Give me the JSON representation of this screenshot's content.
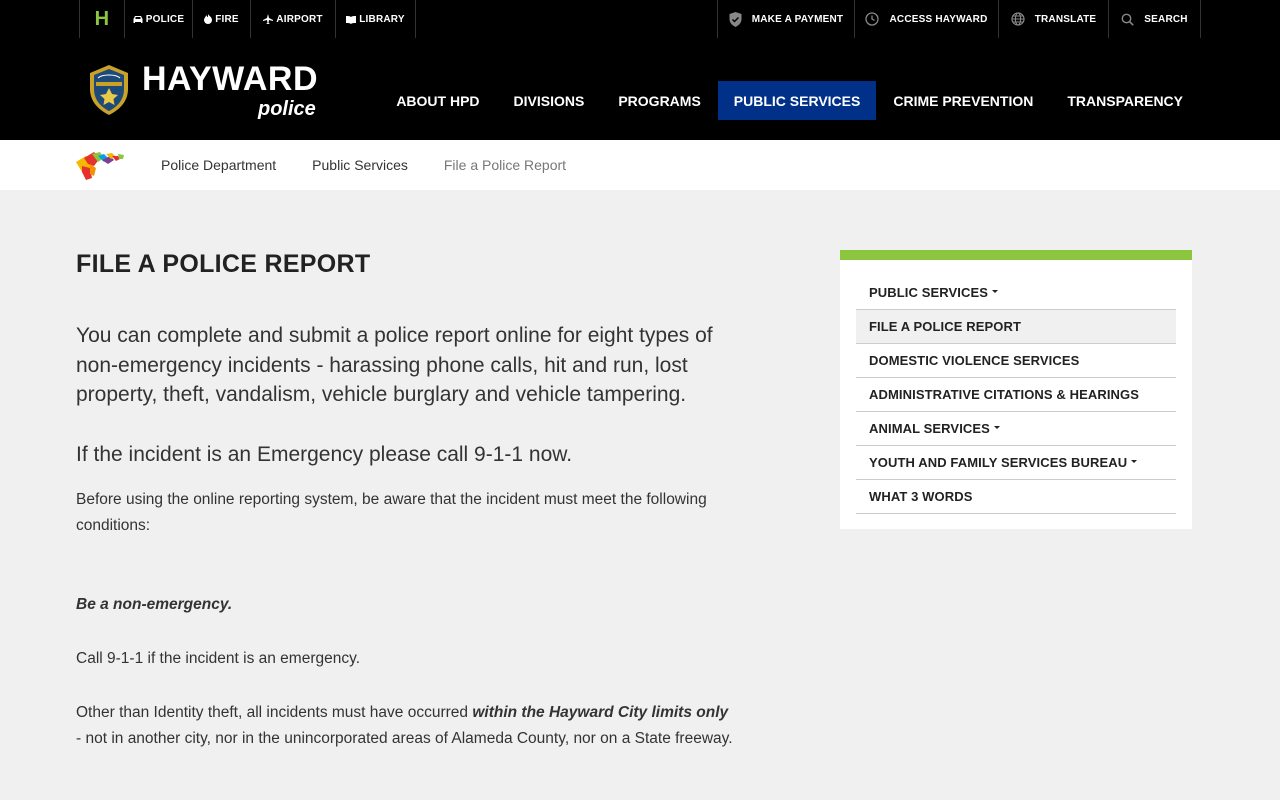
{
  "utility": {
    "home_label": "H",
    "left": [
      {
        "label": "POLICE",
        "icon": "car-icon"
      },
      {
        "label": "FIRE",
        "icon": "flame-icon"
      },
      {
        "label": "AIRPORT",
        "icon": "airplane-icon"
      },
      {
        "label": "LIBRARY",
        "icon": "book-icon"
      }
    ],
    "right": [
      {
        "label": "MAKE A PAYMENT",
        "icon": "shield-check-icon"
      },
      {
        "label": "ACCESS HAYWARD",
        "icon": "clock-icon"
      },
      {
        "label": "TRANSLATE",
        "icon": "globe-icon"
      },
      {
        "label": "SEARCH",
        "icon": "search-icon"
      }
    ]
  },
  "header": {
    "logo_title": "HAYWARD",
    "logo_subtitle": "police",
    "nav": [
      {
        "label": "ABOUT HPD"
      },
      {
        "label": "DIVISIONS"
      },
      {
        "label": "PROGRAMS"
      },
      {
        "label": "PUBLIC SERVICES",
        "active": true
      },
      {
        "label": "CRIME PREVENTION"
      },
      {
        "label": "TRANSPARENCY"
      }
    ]
  },
  "breadcrumb": {
    "items": [
      "Police Department",
      "Public Services"
    ],
    "current": "File a Police Report"
  },
  "content": {
    "title": "FILE A POLICE REPORT",
    "lead": "You can complete and submit a police report online for eight types of non-emergency incidents - harassing phone calls, hit and run, lost property, theft, vandalism, vehicle burglary and vehicle tampering.",
    "emergency": "If the incident is an Emergency please call 9-1-1 now.",
    "p1": "Before using the online reporting system, be aware that the incident must meet the following conditions:",
    "p2": "Be a non-emergency.",
    "p3": "Call 9-1-1 if the incident is an emergency.",
    "p4_pre": "Other than Identity theft, all incidents must have occurred ",
    "p4_bold": "within the Hayward City limits only",
    "p4_post": " - not in another city, nor in the unincorporated areas of Alameda County, nor on a State freeway."
  },
  "sidebar": {
    "items": [
      {
        "label": "PUBLIC SERVICES",
        "caret": true
      },
      {
        "label": "FILE A POLICE REPORT",
        "active": true
      },
      {
        "label": "DOMESTIC VIOLENCE SERVICES"
      },
      {
        "label": "ADMINISTRATIVE CITATIONS & HEARINGS"
      },
      {
        "label": "ANIMAL SERVICES",
        "caret": true
      },
      {
        "label": "YOUTH AND FAMILY SERVICES BUREAU",
        "caret": true
      },
      {
        "label": "WHAT 3 WORDS"
      }
    ]
  },
  "colors": {
    "header_bg": "#000000",
    "nav_active_bg": "#003087",
    "accent_green": "#8cc63f",
    "page_bg": "#f0f0f0"
  }
}
